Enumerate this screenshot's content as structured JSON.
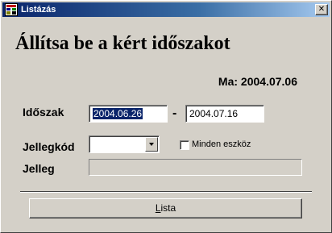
{
  "window": {
    "title": "Listázás",
    "close_glyph": "✕",
    "app_icon": "grid-table-icon"
  },
  "form": {
    "heading": "Állítsa be a kért időszakot",
    "today": "Ma: 2004.07.06",
    "period_label": "Időszak",
    "date_from": "2004.06.26",
    "date_separator": "-",
    "date_to": "2004.07.16",
    "code_label": "Jellegkód",
    "code_value": "",
    "all_devices_label": "Minden eszköz",
    "all_devices_checked": false,
    "nature_label": "Jelleg",
    "nature_value": ""
  },
  "actions": {
    "list_accel": "L",
    "list_rest": "ista"
  },
  "colors": {
    "face": "#d4d0c8",
    "title_start": "#0a246a",
    "title_end": "#a6caf0",
    "selection": "#0a246a"
  }
}
